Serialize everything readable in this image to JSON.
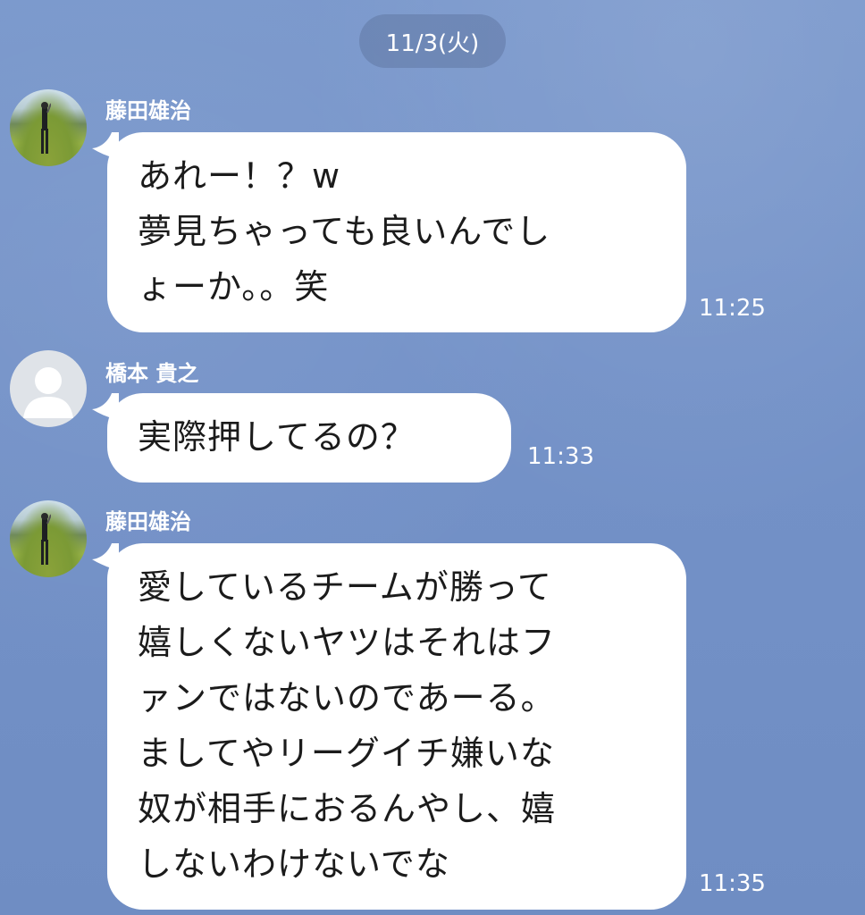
{
  "date_label": "11/3(火)",
  "messages": [
    {
      "sender": "藤田雄治",
      "text": "あれー！？w\n夢見ちゃっても良いんでし\nょーか。。笑",
      "time": "11:25"
    },
    {
      "sender": "橋本 貴之",
      "text": "実際押してるの？",
      "time": "11:33"
    },
    {
      "sender": "藤田雄治",
      "text": "愛しているチームが勝って\n嬉しくないヤツはそれはフ\nァンではないのであーる。\nましてやリーグイチ嫌いな\n奴が相手におるんやし、嬉\nしないわけないでな",
      "time": "11:35"
    }
  ],
  "colors": {
    "background": "#7090c4",
    "bubble": "#ffffff",
    "text": "#1b1b1b"
  }
}
